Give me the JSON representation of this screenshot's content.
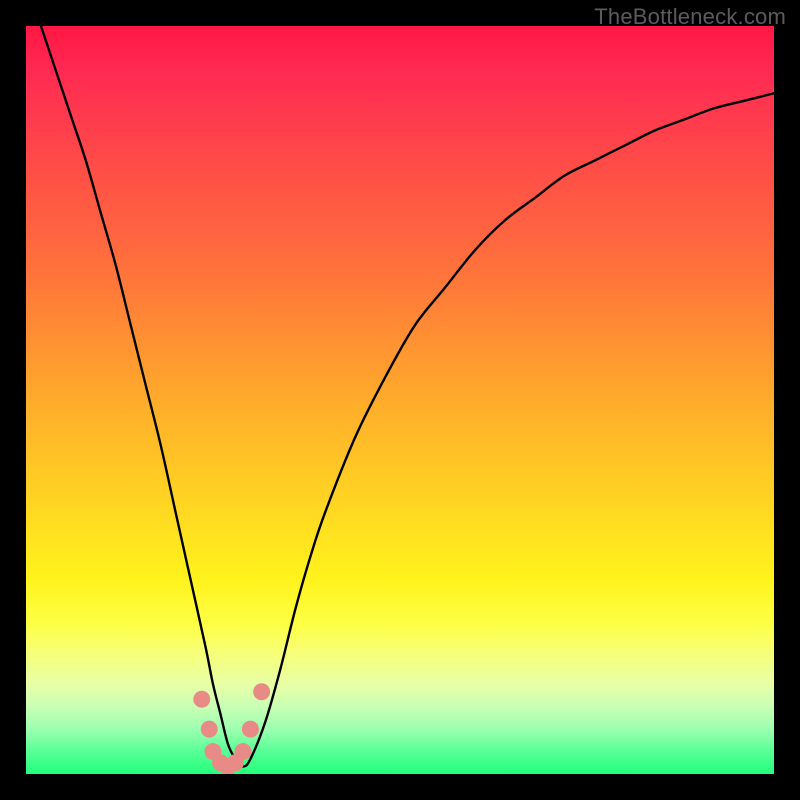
{
  "watermark": "TheBottleneck.com",
  "chart_data": {
    "type": "line",
    "title": "",
    "xlabel": "",
    "ylabel": "",
    "xlim": [
      0,
      100
    ],
    "ylim": [
      0,
      100
    ],
    "series": [
      {
        "name": "bottleneck-curve",
        "x": [
          2,
          4,
          6,
          8,
          10,
          12,
          14,
          16,
          18,
          20,
          22,
          24,
          25,
          26,
          27,
          28,
          29,
          30,
          32,
          34,
          36,
          38,
          40,
          44,
          48,
          52,
          56,
          60,
          64,
          68,
          72,
          76,
          80,
          84,
          88,
          92,
          96,
          100
        ],
        "values": [
          100,
          94,
          88,
          82,
          75,
          68,
          60,
          52,
          44,
          35,
          26,
          17,
          12,
          8,
          4,
          2,
          1,
          2,
          7,
          14,
          22,
          29,
          35,
          45,
          53,
          60,
          65,
          70,
          74,
          77,
          80,
          82,
          84,
          86,
          87.5,
          89,
          90,
          91
        ]
      }
    ],
    "markers": {
      "name": "min-region-dots",
      "color": "#e88b87",
      "points": [
        {
          "x": 23.5,
          "y": 10
        },
        {
          "x": 24.5,
          "y": 6
        },
        {
          "x": 25.0,
          "y": 3
        },
        {
          "x": 26.0,
          "y": 1.5
        },
        {
          "x": 27.0,
          "y": 1
        },
        {
          "x": 28.0,
          "y": 1.5
        },
        {
          "x": 29.0,
          "y": 3
        },
        {
          "x": 30.0,
          "y": 6
        },
        {
          "x": 31.5,
          "y": 11
        }
      ]
    },
    "background_gradient": {
      "top": "#ff1744",
      "mid_upper": "#ff8a34",
      "mid_lower": "#fff31c",
      "bottom": "#22ff7c"
    }
  }
}
